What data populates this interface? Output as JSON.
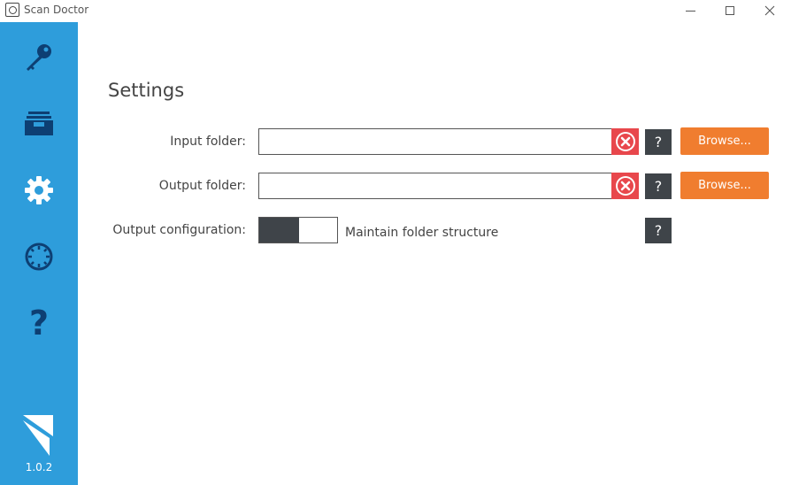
{
  "window": {
    "title": "Scan Doctor",
    "controls": [
      "minimize",
      "maximize",
      "close"
    ]
  },
  "sidebar": {
    "accent": "#2e9ddb",
    "items": [
      {
        "icon": "key-icon"
      },
      {
        "icon": "archive-icon"
      },
      {
        "icon": "gear-icon"
      },
      {
        "icon": "clock-icon"
      },
      {
        "icon": "help-icon",
        "label": "?"
      }
    ],
    "version": "1.0.2"
  },
  "settings": {
    "title": "Settings",
    "input_folder": {
      "label": "Input folder:",
      "value": "",
      "help": "?",
      "browse": "Browse..."
    },
    "output_folder": {
      "label": "Output folder:",
      "value": "",
      "help": "?",
      "browse": "Browse..."
    },
    "output_configuration": {
      "label": "Output configuration:",
      "toggle_on": false,
      "option_label": "Maintain folder structure",
      "help": "?"
    }
  },
  "colors": {
    "error": "#e8474c",
    "button_orange": "#f07d2f",
    "help_dark": "#3f4449"
  }
}
